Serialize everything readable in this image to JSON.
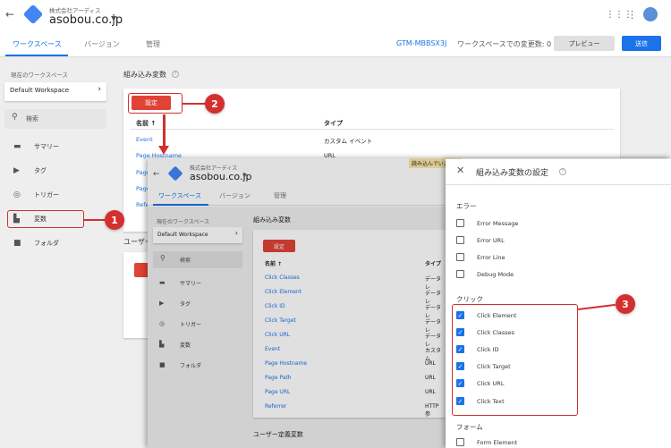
{
  "topbar": {
    "company": "株式会社アーディス",
    "domain": "asobou.co.jp"
  },
  "tabs": [
    "ワークスペース",
    "バージョン",
    "管理"
  ],
  "container_id": "GTM-MBBSX3J",
  "ws_changes": "ワークスペースでの変更数: 0",
  "preview": "プレビュー",
  "send": "送信",
  "sidebar": {
    "current_ws_label": "現在のワークスペース",
    "ws_name": "Default Workspace",
    "search": "検索",
    "items": [
      "サマリー",
      "タグ",
      "トリガー",
      "変数",
      "フォルダ"
    ]
  },
  "main": {
    "title": "組み込み変数",
    "configure": "設定",
    "col_name": "名前 ↑",
    "col_type": "タイプ",
    "rows": [
      {
        "name": "Event",
        "type": "カスタム イベント"
      },
      {
        "name": "Page Hostname",
        "type": "URL"
      },
      {
        "name": "Page",
        "type": ""
      },
      {
        "name": "Page",
        "type": ""
      },
      {
        "name": "Refer",
        "type": ""
      }
    ],
    "user_defined": "ユーザー"
  },
  "overlay": {
    "company": "株式会社アーディス",
    "domain": "asobou.co.jp",
    "loading": "読み込んでいます...",
    "tabs": [
      "ワークスペース",
      "バージョン",
      "管理"
    ],
    "sidebar": {
      "current_ws_label": "現在のワークスペース",
      "ws_name": "Default Workspace",
      "search": "検索",
      "items": [
        "サマリー",
        "タグ",
        "トリガー",
        "変数",
        "フォルダ"
      ]
    },
    "title": "組み込み変数",
    "configure": "設定",
    "col_name": "名前 ↑",
    "col_type": "タイプ",
    "rows": [
      {
        "name": "Click Classes",
        "type": "データレ"
      },
      {
        "name": "Click Element",
        "type": "データレ"
      },
      {
        "name": "Click ID",
        "type": "データレ"
      },
      {
        "name": "Click Target",
        "type": "データレ"
      },
      {
        "name": "Click URL",
        "type": "データレ"
      },
      {
        "name": "Event",
        "type": "カスタム"
      },
      {
        "name": "Page Hostname",
        "type": "URL"
      },
      {
        "name": "Page Path",
        "type": "URL"
      },
      {
        "name": "Page URL",
        "type": "URL"
      },
      {
        "name": "Referrer",
        "type": "HTTP 参"
      }
    ],
    "user_defined": "ユーザー定義変数"
  },
  "panel": {
    "title": "組み込み変数の設定",
    "sections": [
      {
        "name": "エラー",
        "items": [
          {
            "label": "Error Message",
            "checked": false
          },
          {
            "label": "Error URL",
            "checked": false
          },
          {
            "label": "Error Line",
            "checked": false
          },
          {
            "label": "Debug Mode",
            "checked": false
          }
        ]
      },
      {
        "name": "クリック",
        "items": [
          {
            "label": "Click Element",
            "checked": true
          },
          {
            "label": "Click Classes",
            "checked": true
          },
          {
            "label": "Click ID",
            "checked": true
          },
          {
            "label": "Click Target",
            "checked": true
          },
          {
            "label": "Click URL",
            "checked": true
          },
          {
            "label": "Click Text",
            "checked": true
          }
        ]
      },
      {
        "name": "フォーム",
        "items": [
          {
            "label": "Form Element",
            "checked": false
          }
        ]
      }
    ]
  },
  "annotations": [
    "1",
    "2",
    "3"
  ],
  "colors": {
    "accent": "#1a73e8",
    "annotation": "#d32f2f",
    "button": "#e04235"
  }
}
